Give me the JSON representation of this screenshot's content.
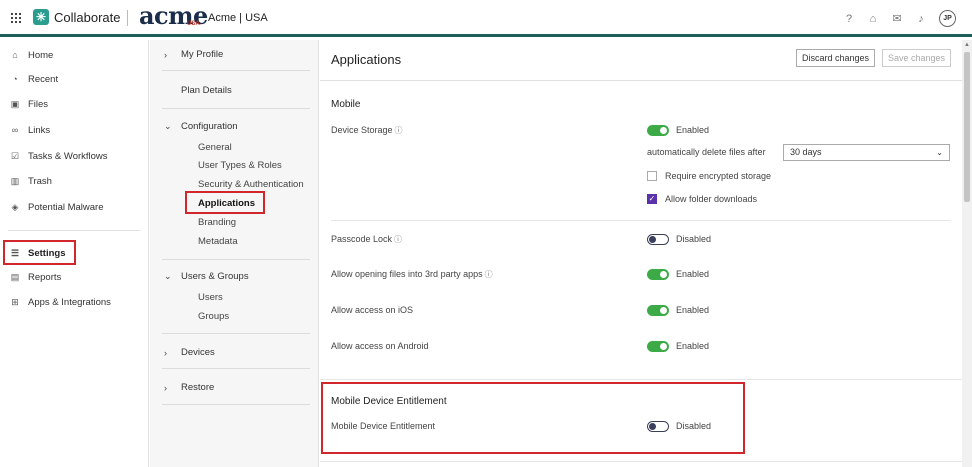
{
  "header": {
    "app_name": "Collaborate",
    "brand": "acme",
    "brand_sub": "USA",
    "org": "Acme | USA",
    "avatar_initials": "JP",
    "icons": [
      "help-icon",
      "graduation-icon",
      "megaphone-icon",
      "bell-icon"
    ]
  },
  "leftnav": {
    "items": [
      {
        "label": "Home",
        "icon": "home-icon"
      },
      {
        "label": "Recent",
        "icon": "clock-icon"
      },
      {
        "label": "Files",
        "icon": "folder-icon"
      },
      {
        "label": "Links",
        "icon": "link-icon"
      },
      {
        "label": "Tasks & Workflows",
        "icon": "clipboard-icon"
      },
      {
        "label": "Trash",
        "icon": "trash-icon"
      },
      {
        "label": "Potential Malware",
        "icon": "shield-icon"
      },
      {
        "label": "Settings",
        "icon": "sliders-icon"
      },
      {
        "label": "Reports",
        "icon": "report-icon"
      },
      {
        "label": "Apps & Integrations",
        "icon": "apps-icon"
      }
    ]
  },
  "subnav": {
    "my_profile": "My Profile",
    "plan_details": "Plan Details",
    "configuration": "Configuration",
    "config_children": [
      "General",
      "User Types & Roles",
      "Security & Authentication",
      "Applications",
      "Branding",
      "Metadata"
    ],
    "users_groups": "Users & Groups",
    "users_children": [
      "Users",
      "Groups"
    ],
    "devices": "Devices",
    "restore": "Restore"
  },
  "main": {
    "title": "Applications",
    "discard_label": "Discard changes",
    "save_label": "Save changes",
    "mobile_section": "Mobile",
    "device_storage": {
      "label": "Device Storage",
      "state": "Enabled",
      "auto_delete_label": "automatically delete files after",
      "auto_delete_value": "30 days",
      "require_encrypted": "Require encrypted storage",
      "allow_folder_downloads": "Allow folder downloads"
    },
    "passcode": {
      "label": "Passcode Lock",
      "state": "Disabled"
    },
    "third_party": {
      "label": "Allow opening files into 3rd party apps",
      "state": "Enabled"
    },
    "ios": {
      "label": "Allow access on iOS",
      "state": "Enabled"
    },
    "android": {
      "label": "Allow access on Android",
      "state": "Enabled"
    },
    "mde_section": "Mobile Device Entitlement",
    "mde": {
      "label": "Mobile Device Entitlement",
      "state": "Disabled"
    }
  },
  "colors": {
    "toggle_on": "#3cab47",
    "accent": "#1f5f5b",
    "highlight": "#d0262c",
    "checkbox": "#5b33a8"
  }
}
